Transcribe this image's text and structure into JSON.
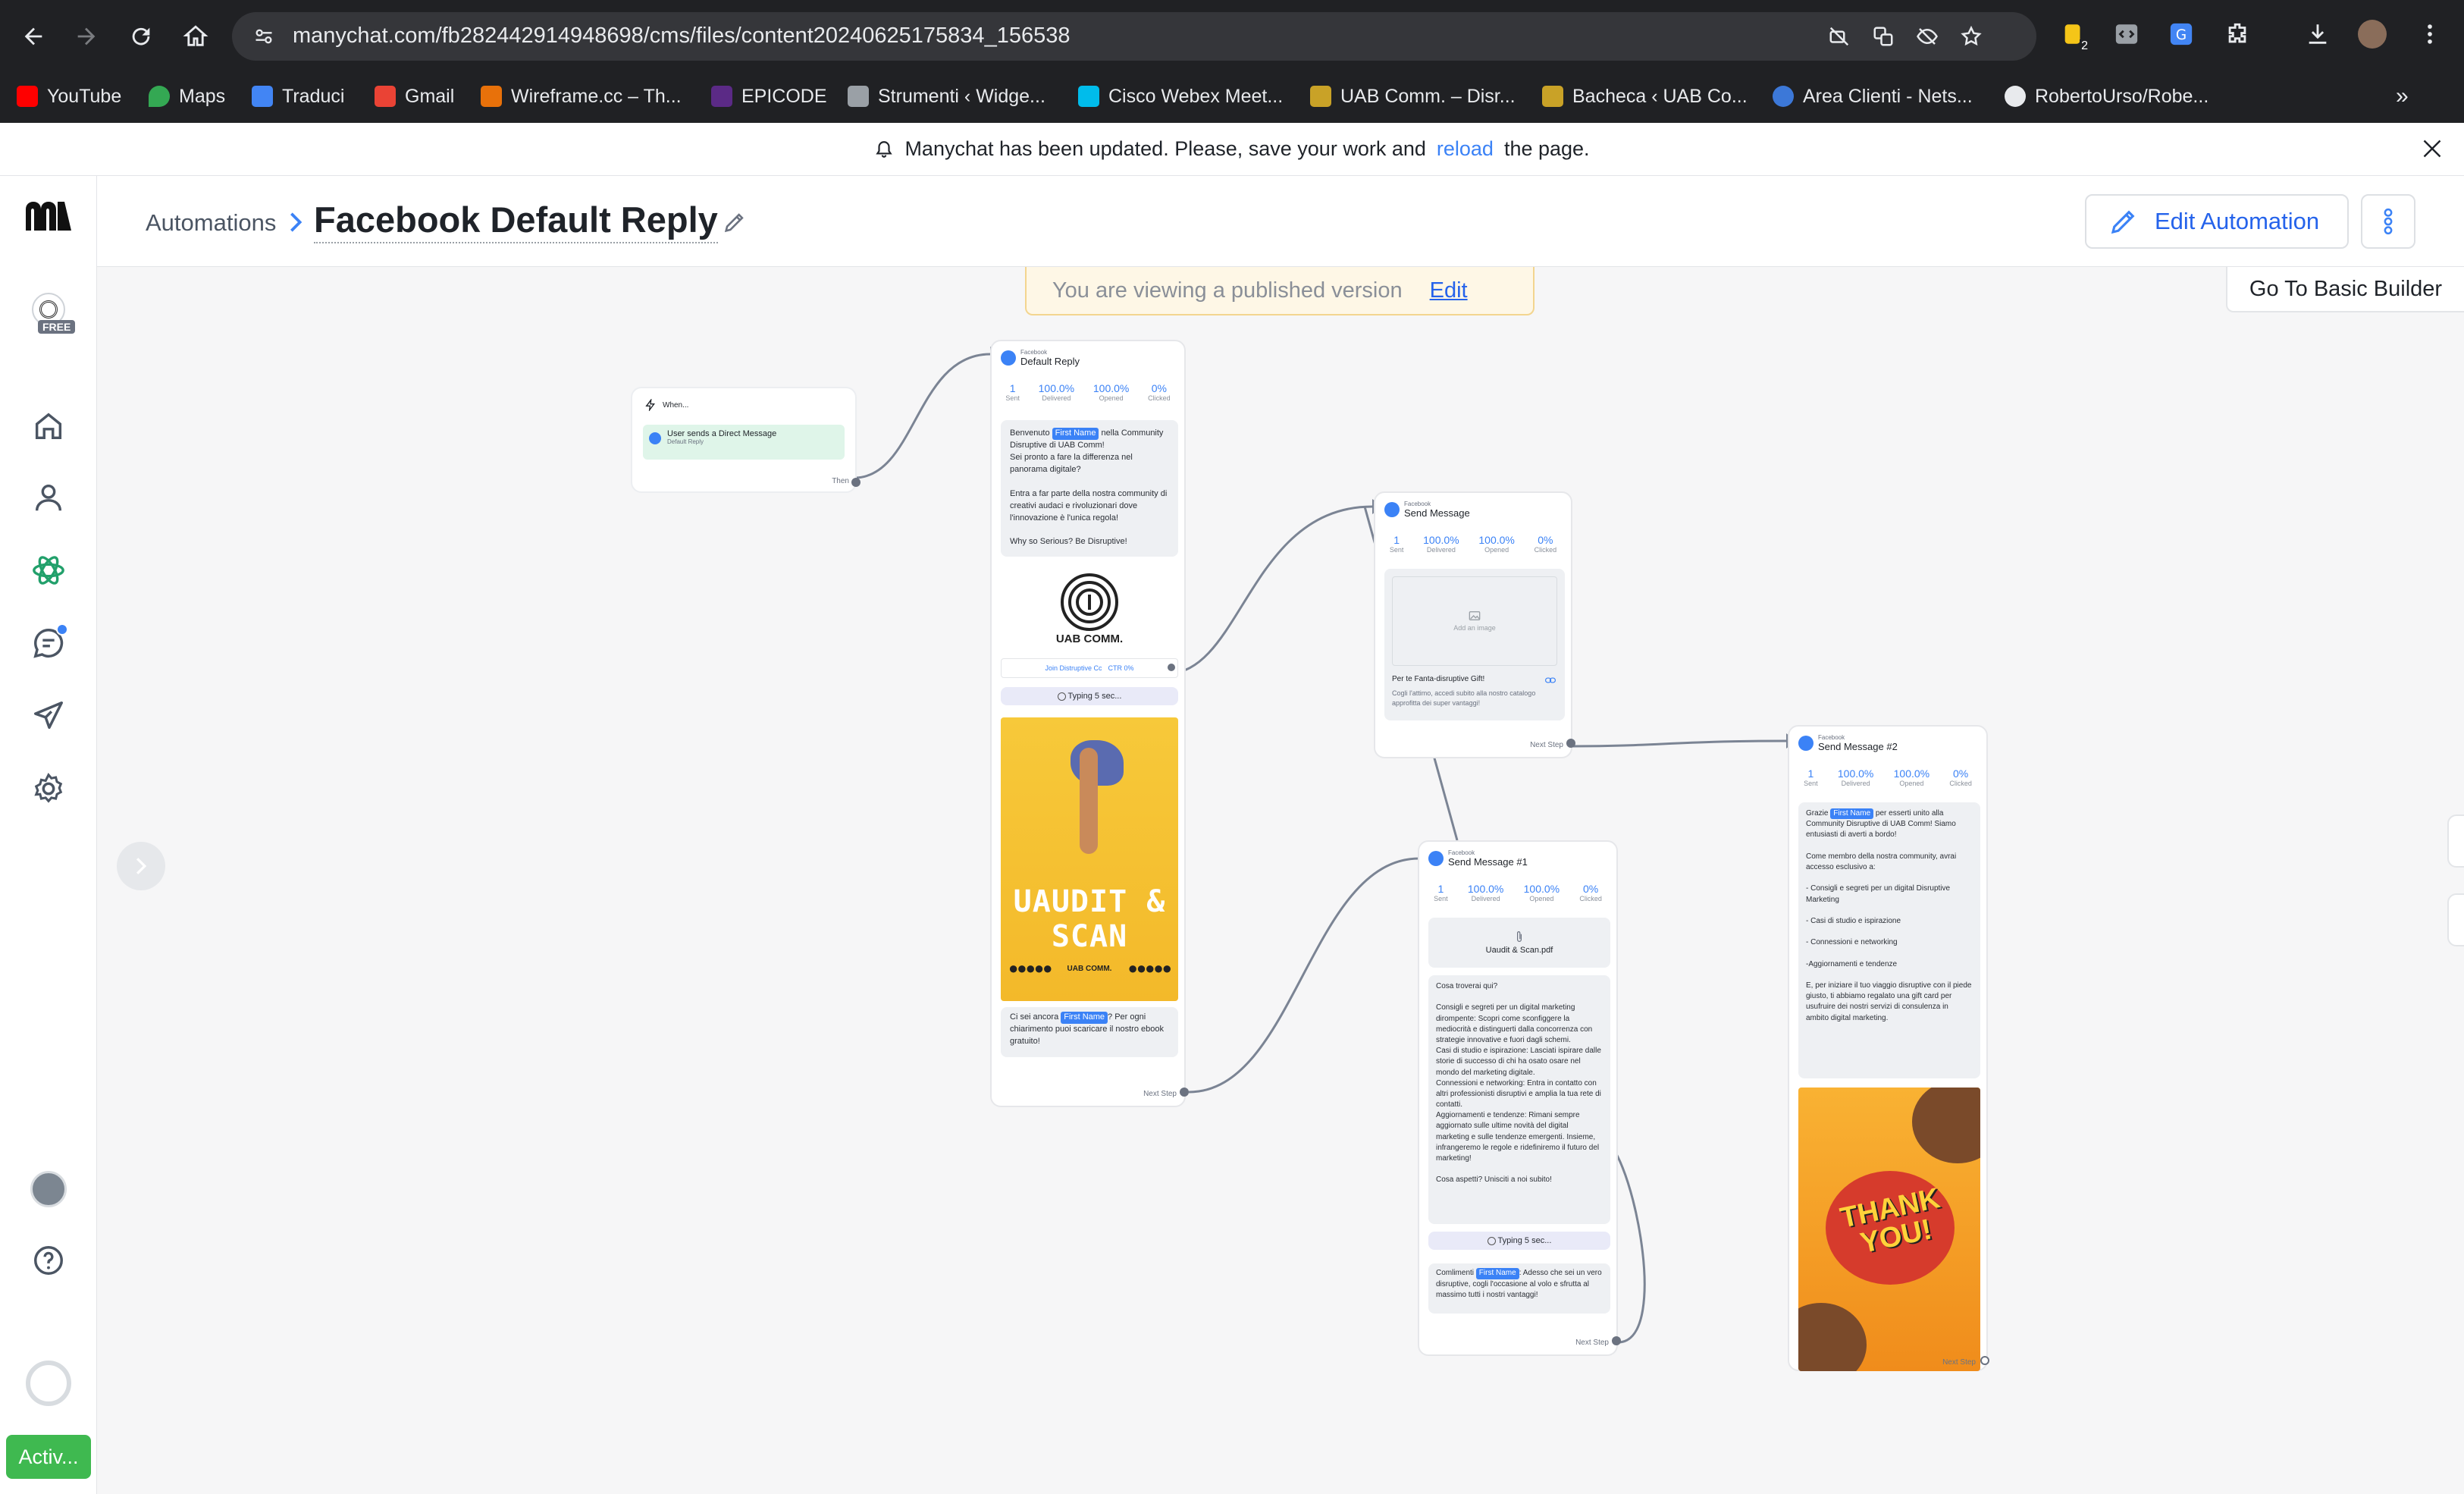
{
  "browser": {
    "url": "manychat.com/fb282442914948698/cms/files/content20240625175834_156538",
    "extension_badge": "2",
    "bookmarks": [
      "YouTube",
      "Maps",
      "Traduci",
      "Gmail",
      "Wireframe.cc – Th...",
      "EPICODE",
      "Strumenti ‹ Widge...",
      "Cisco Webex Meet...",
      "UAB Comm. – Disr...",
      "Bacheca ‹ UAB Co...",
      "Area Clienti - Nets...",
      "RobertoUrso/Robe..."
    ]
  },
  "banner": {
    "text": "Manychat has been updated. Please, save your work and",
    "link": "reload",
    "text_after": "the page."
  },
  "sidebar": {
    "plan_badge": "FREE",
    "active_label": "Activ..."
  },
  "header": {
    "breadcrumb_parent": "Automations",
    "title": "Facebook Default Reply",
    "edit_button": "Edit Automation"
  },
  "notice": {
    "text": "You are viewing a published version",
    "link": "Edit"
  },
  "basic_builder": "Go To Basic Builder",
  "canvas": {
    "trigger": {
      "title": "When...",
      "item": "User sends a Direct Message",
      "subitem": "Default Reply",
      "then": "Then"
    },
    "node_default": {
      "platform": "Facebook",
      "title": "Default Reply",
      "stats": [
        {
          "v": "1",
          "l": "Sent"
        },
        {
          "v": "100.0%",
          "l": "Delivered"
        },
        {
          "v": "100.0%",
          "l": "Opened"
        },
        {
          "v": "0%",
          "l": "Clicked"
        }
      ],
      "msg1_a": "Benvenuto",
      "msg1_name": "First Name",
      "msg1_b": "nella Community Disruptive di UAB Comm!\nSei pronto a fare la differenza nel panorama digitale?\n\nEntra a far parte della nostra community di creativi audaci e rivoluzionari dove l'innovazione è l'unica regola!\n\nWhy so Serious? Be Disruptive!",
      "logo_text": "UAB COMM.",
      "button_label": "Join Distruptive Cc",
      "button_ctr": "CTR 0%",
      "typing": "Typing 5 sec...",
      "poster_text": "UAUDIT & SCAN",
      "poster_logo": "UAB COMM.",
      "msg2_a": "Ci sei ancora",
      "msg2_name": "First Name",
      "msg2_b": "? Per ogni chiarimento puoi scaricare il nostro ebook gratuito!",
      "next": "Next Step"
    },
    "node_send": {
      "platform": "Facebook",
      "title": "Send Message",
      "stats": [
        {
          "v": "1",
          "l": "Sent"
        },
        {
          "v": "100.0%",
          "l": "Delivered"
        },
        {
          "v": "100.0%",
          "l": "Opened"
        },
        {
          "v": "0%",
          "l": "Clicked"
        }
      ],
      "image_placeholder": "Add an image",
      "card_title": "Per te Fanta-disruptive Gift!",
      "card_sub": "Cogli l'attimo, accedi subito alla nostro catalogo approfitta dei super vantaggi!",
      "next": "Next Step"
    },
    "node_send1": {
      "platform": "Facebook",
      "title": "Send Message #1",
      "stats": [
        {
          "v": "1",
          "l": "Sent"
        },
        {
          "v": "100.0%",
          "l": "Delivered"
        },
        {
          "v": "100.0%",
          "l": "Opened"
        },
        {
          "v": "0%",
          "l": "Clicked"
        }
      ],
      "file": "Uaudit & Scan.pdf",
      "msg": "Cosa troverai qui?\n\nConsigli e segreti per un digital marketing dirompente: Scopri come sconfiggere la mediocrità e distinguerti dalla concorrenza con strategie innovative e fuori dagli schemi.\nCasi di studio e ispirazione: Lasciati ispirare dalle storie di successo di chi ha osato osare nel mondo del marketing digitale.\nConnessioni e networking: Entra in contatto con altri professionisti disruptivi e amplia la tua rete di contatti.\nAggiornamenti e tendenze: Rimani sempre aggiornato sulle ultime novità del digital marketing e sulle tendenze emergenti. Insieme, infrangeremo le regole e ridefiniremo il futuro del marketing!\n\nCosa aspetti? Unisciti a noi subito!",
      "typing": "Typing 5 sec...",
      "msg2_a": "Comlimenti",
      "msg2_name": "First Name",
      "msg2_b": ": Adesso che sei un vero disruptive, cogli l'occasione al volo e sfrutta al massimo tutti i nostri vantaggi!",
      "next": "Next Step"
    },
    "node_send2": {
      "platform": "Facebook",
      "title": "Send Message #2",
      "stats": [
        {
          "v": "1",
          "l": "Sent"
        },
        {
          "v": "100.0%",
          "l": "Delivered"
        },
        {
          "v": "100.0%",
          "l": "Opened"
        },
        {
          "v": "0%",
          "l": "Clicked"
        }
      ],
      "msg_a": "Grazie",
      "msg_name": "First Name",
      "msg_b": "per esserti unito alla Community Disruptive di UAB Comm! Siamo entusiasti di averti a bordo!\n\nCome membro della nostra community, avrai accesso esclusivo a:\n\n- Consigli e segreti per un digital Disruptive Marketing\n\n- Casi di studio e ispirazione\n\n- Connessioni e networking\n\n-Aggiornamenti e tendenze\n\nE, per iniziare il tuo viaggio disruptive con il piede giusto, ti abbiamo regalato una gift card per usufruire dei nostri servizi di consulenza in ambito digital marketing.",
      "thank_you": "THANK YOU!",
      "next": "Next Step"
    }
  }
}
